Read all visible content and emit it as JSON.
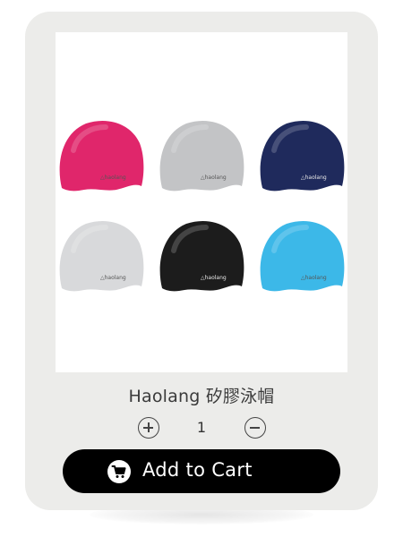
{
  "product": {
    "title": "Haolang 矽膠泳帽",
    "brand_marking": "haolang",
    "cap_colors": [
      "#e0266b",
      "#c3c4c6",
      "#1f2a5c",
      "#d8d9db",
      "#1c1c1c",
      "#3cb8e8"
    ]
  },
  "quantity": {
    "value": "1",
    "increase_icon": "plus-circle-icon",
    "decrease_icon": "minus-circle-icon"
  },
  "cart": {
    "button_label": "Add to Cart",
    "icon": "shopping-cart-icon"
  }
}
